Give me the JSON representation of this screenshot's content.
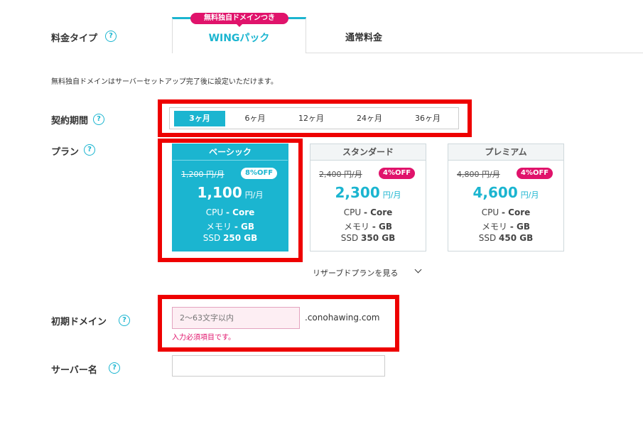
{
  "price_type": {
    "label": "料金タイプ",
    "tabs": [
      {
        "label": "WINGパック",
        "badge": "無料独自ドメインつき",
        "active": true
      },
      {
        "label": "通常料金",
        "active": false
      }
    ]
  },
  "notice": "無料独自ドメインはサーバーセットアップ完了後に設定いただけます。",
  "period": {
    "label": "契約期間",
    "options": [
      "3ヶ月",
      "6ヶ月",
      "12ヶ月",
      "24ヶ月",
      "36ヶ月"
    ],
    "selected": "3ヶ月"
  },
  "plan": {
    "label": "プラン",
    "cards": [
      {
        "name": "ベーシック",
        "original": "1,200 円/月",
        "discount": "8%OFF",
        "price": "1,100",
        "unit": "円/月",
        "cpu_label": "CPU",
        "cpu": "- Core",
        "mem_label": "メモリ",
        "mem": "- GB",
        "ssd_label": "SSD",
        "ssd": "250 GB",
        "selected": true
      },
      {
        "name": "スタンダード",
        "original": "2,400 円/月",
        "discount": "4%OFF",
        "price": "2,300",
        "unit": "円/月",
        "cpu_label": "CPU",
        "cpu": "- Core",
        "mem_label": "メモリ",
        "mem": "- GB",
        "ssd_label": "SSD",
        "ssd": "350 GB",
        "selected": false
      },
      {
        "name": "プレミアム",
        "original": "4,800 円/月",
        "discount": "4%OFF",
        "price": "4,600",
        "unit": "円/月",
        "cpu_label": "CPU",
        "cpu": "- Core",
        "mem_label": "メモリ",
        "mem": "- GB",
        "ssd_label": "SSD",
        "ssd": "450 GB",
        "selected": false
      }
    ],
    "reserve_link": "リザーブドプランを見る"
  },
  "domain": {
    "label": "初期ドメイン",
    "placeholder": "2〜63文字以内",
    "suffix": ".conohawing.com",
    "error": "入力必須項目です。"
  },
  "server_name": {
    "label": "サーバー名",
    "value": ""
  },
  "help_glyph": "?",
  "colors": {
    "accent": "#1bb5d0",
    "pink": "#e0136b",
    "highlight": "#ee0000"
  }
}
